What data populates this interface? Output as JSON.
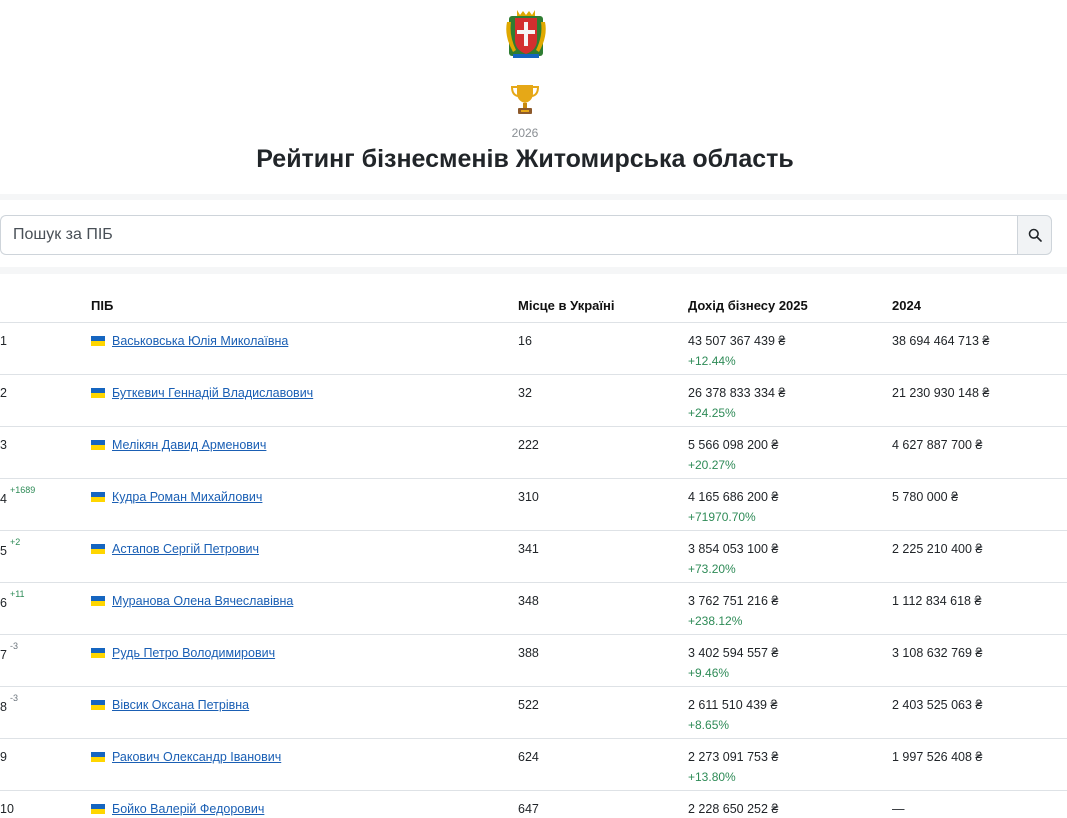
{
  "header": {
    "year": "2026",
    "title": "Рейтинг бізнесменів Житомирська область"
  },
  "search": {
    "placeholder": "Пошук за ПІБ"
  },
  "table": {
    "columns": {
      "rank": "",
      "name": "ПІБ",
      "place": "Місце в Україні",
      "income": "Дохід бізнесу 2025",
      "prev": "2024"
    },
    "rows": [
      {
        "rank": "1",
        "delta": "",
        "delta_dir": "",
        "name": "Васьковська Юлія Миколаївна",
        "place": "16",
        "income": "43 507 367 439 ₴",
        "growth": "+12.44%",
        "prev": "38 694 464 713 ₴"
      },
      {
        "rank": "2",
        "delta": "",
        "delta_dir": "",
        "name": "Буткевич Геннадій Владиславович",
        "place": "32",
        "income": "26 378 833 334 ₴",
        "growth": "+24.25%",
        "prev": "21 230 930 148 ₴"
      },
      {
        "rank": "3",
        "delta": "",
        "delta_dir": "",
        "name": "Мелікян Давид Арменович",
        "place": "222",
        "income": "5 566 098 200 ₴",
        "growth": "+20.27%",
        "prev": "4 627 887 700 ₴"
      },
      {
        "rank": "4",
        "delta": "+1689",
        "delta_dir": "up",
        "name": "Кудра Роман Михайлович",
        "place": "310",
        "income": "4 165 686 200 ₴",
        "growth": "+71970.70%",
        "prev": "5 780 000 ₴"
      },
      {
        "rank": "5",
        "delta": "+2",
        "delta_dir": "up",
        "name": "Астапов Сергій Петрович",
        "place": "341",
        "income": "3 854 053 100 ₴",
        "growth": "+73.20%",
        "prev": "2 225 210 400 ₴"
      },
      {
        "rank": "6",
        "delta": "+11",
        "delta_dir": "up",
        "name": "Муранова Олена Вячеславівна",
        "place": "348",
        "income": "3 762 751 216 ₴",
        "growth": "+238.12%",
        "prev": "1 112 834 618 ₴"
      },
      {
        "rank": "7",
        "delta": "-3",
        "delta_dir": "down",
        "name": "Рудь Петро Володимирович",
        "place": "388",
        "income": "3 402 594 557 ₴",
        "growth": "+9.46%",
        "prev": "3 108 632 769 ₴"
      },
      {
        "rank": "8",
        "delta": "-3",
        "delta_dir": "down",
        "name": "Вівсик Оксана Петрівна",
        "place": "522",
        "income": "2 611 510 439 ₴",
        "growth": "+8.65%",
        "prev": "2 403 525 063 ₴"
      },
      {
        "rank": "9",
        "delta": "",
        "delta_dir": "",
        "name": "Ракович Олександр Іванович",
        "place": "624",
        "income": "2 273 091 753 ₴",
        "growth": "+13.80%",
        "prev": "1 997 526 408 ₴"
      },
      {
        "rank": "10",
        "delta": "",
        "delta_dir": "",
        "name": "Бойко Валерій Федорович",
        "place": "647",
        "income": "2 228 650 252 ₴",
        "growth": "",
        "prev": "—"
      }
    ]
  },
  "colors": {
    "link": "#1a5fb4",
    "growth": "#2e8b57",
    "flag_blue": "#1565c0",
    "flag_yellow": "#ffd600"
  },
  "icons": {
    "emblem": "zhytomyr-coat-of-arms-icon",
    "trophy": "trophy-icon",
    "search": "search-icon",
    "flag": "ukraine-flag-icon"
  }
}
